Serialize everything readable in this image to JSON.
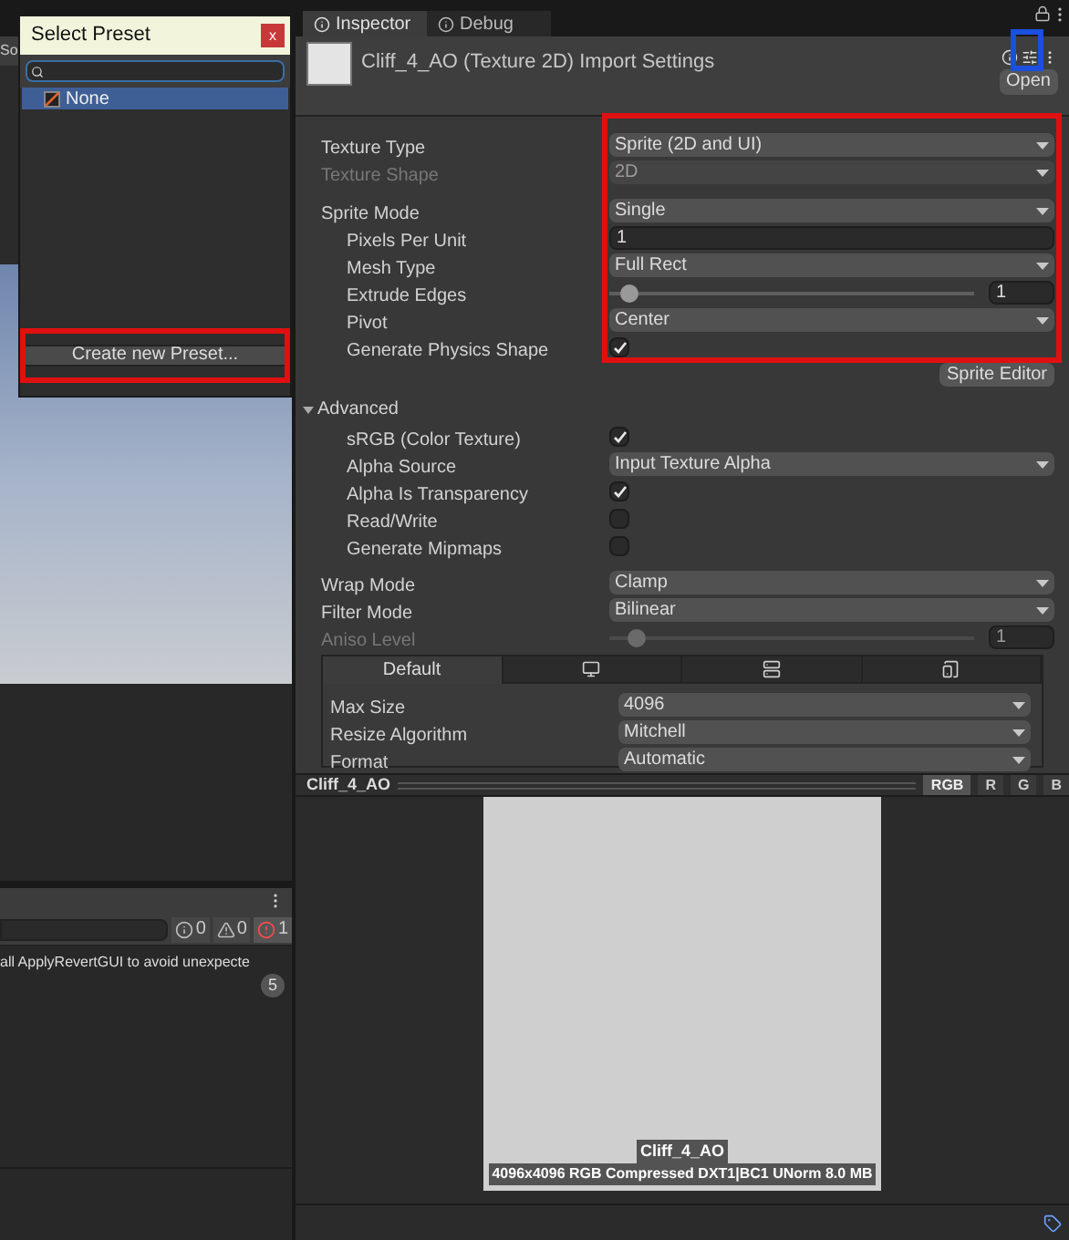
{
  "scene_view": {
    "tab_label": "So"
  },
  "preset_popup": {
    "title": "Select Preset",
    "close_label": "x",
    "items": [
      {
        "label": "None",
        "selected": true
      }
    ],
    "create_button": "Create new Preset...",
    "highlighted": true
  },
  "console": {
    "counts": [
      {
        "kind": "info",
        "count": "0"
      },
      {
        "kind": "warning",
        "count": "0"
      },
      {
        "kind": "error",
        "count": "1"
      }
    ],
    "message": "all ApplyRevertGUI to avoid unexpecte",
    "message_count": "5"
  },
  "inspector": {
    "tabs": [
      {
        "label": "Inspector",
        "selected": true
      },
      {
        "label": "Debug",
        "selected": false
      }
    ],
    "title": "Cliff_4_AO (Texture 2D) Import Settings",
    "open_button": "Open",
    "presets_highlighted": true,
    "values_highlighted": true,
    "texture_rows": [
      {
        "kind": "dropdown",
        "label": "Texture Type",
        "value": "Sprite (2D and UI)",
        "disabled": false
      },
      {
        "kind": "dropdown",
        "label": "Texture Shape",
        "value": "2D",
        "disabled": true
      }
    ],
    "sprite_rows": [
      {
        "kind": "dropdown",
        "label": "Sprite Mode",
        "value": "Single",
        "disabled": false,
        "children": [
          {
            "kind": "input",
            "label": "Pixels Per Unit",
            "value": "1",
            "disabled": false
          },
          {
            "kind": "dropdown",
            "label": "Mesh Type",
            "value": "Full Rect",
            "disabled": false
          },
          {
            "kind": "slider",
            "label": "Extrude Edges",
            "value": "1",
            "level": 0.03,
            "disabled": false
          },
          {
            "kind": "dropdown",
            "label": "Pivot",
            "value": "Center",
            "disabled": false
          },
          {
            "kind": "checkbox",
            "label": "Generate Physics Shape",
            "checked": true,
            "disabled": false
          }
        ]
      }
    ],
    "sprite_editor_button": "Sprite Editor",
    "advanced": {
      "label": "Advanced",
      "expanded": true,
      "rows": [
        {
          "kind": "checkbox",
          "label": "sRGB (Color Texture)",
          "checked": true,
          "disabled": false
        },
        {
          "kind": "dropdown",
          "label": "Alpha Source",
          "value": "Input Texture Alpha",
          "disabled": false
        },
        {
          "kind": "checkbox",
          "label": "Alpha Is Transparency",
          "checked": true,
          "disabled": false
        },
        {
          "kind": "checkbox",
          "label": "Read/Write",
          "checked": false,
          "disabled": false
        },
        {
          "kind": "checkbox",
          "label": "Generate Mipmaps",
          "checked": false,
          "disabled": false
        }
      ]
    },
    "sampling_rows": [
      {
        "kind": "dropdown",
        "label": "Wrap Mode",
        "value": "Clamp",
        "disabled": false
      },
      {
        "kind": "dropdown",
        "label": "Filter Mode",
        "value": "Bilinear",
        "disabled": false
      },
      {
        "kind": "slider",
        "label": "Aniso Level",
        "value": "1",
        "level": 0.05,
        "disabled": true
      }
    ],
    "platform_tabs": [
      {
        "kind": "text",
        "label": "Default",
        "selected": true
      },
      {
        "kind": "monitor",
        "selected": false
      },
      {
        "kind": "server",
        "selected": false
      },
      {
        "kind": "device",
        "selected": false
      }
    ],
    "platform_rows": [
      {
        "kind": "dropdown",
        "label": "Max Size",
        "value": "4096",
        "disabled": false
      },
      {
        "kind": "dropdown",
        "label": "Resize Algorithm",
        "value": "Mitchell",
        "disabled": false
      },
      {
        "kind": "dropdown",
        "label": "Format",
        "value": "Automatic",
        "disabled": false
      }
    ]
  },
  "preview": {
    "title": "Cliff_4_AO",
    "channels": [
      {
        "label": "RGB",
        "selected": true
      },
      {
        "label": "R",
        "selected": false
      },
      {
        "label": "G",
        "selected": false
      },
      {
        "label": "B",
        "selected": false
      }
    ],
    "caption": "Cliff_4_AO",
    "info": "4096x4096  RGB Compressed DXT1|BC1 UNorm   8.0 MB"
  }
}
